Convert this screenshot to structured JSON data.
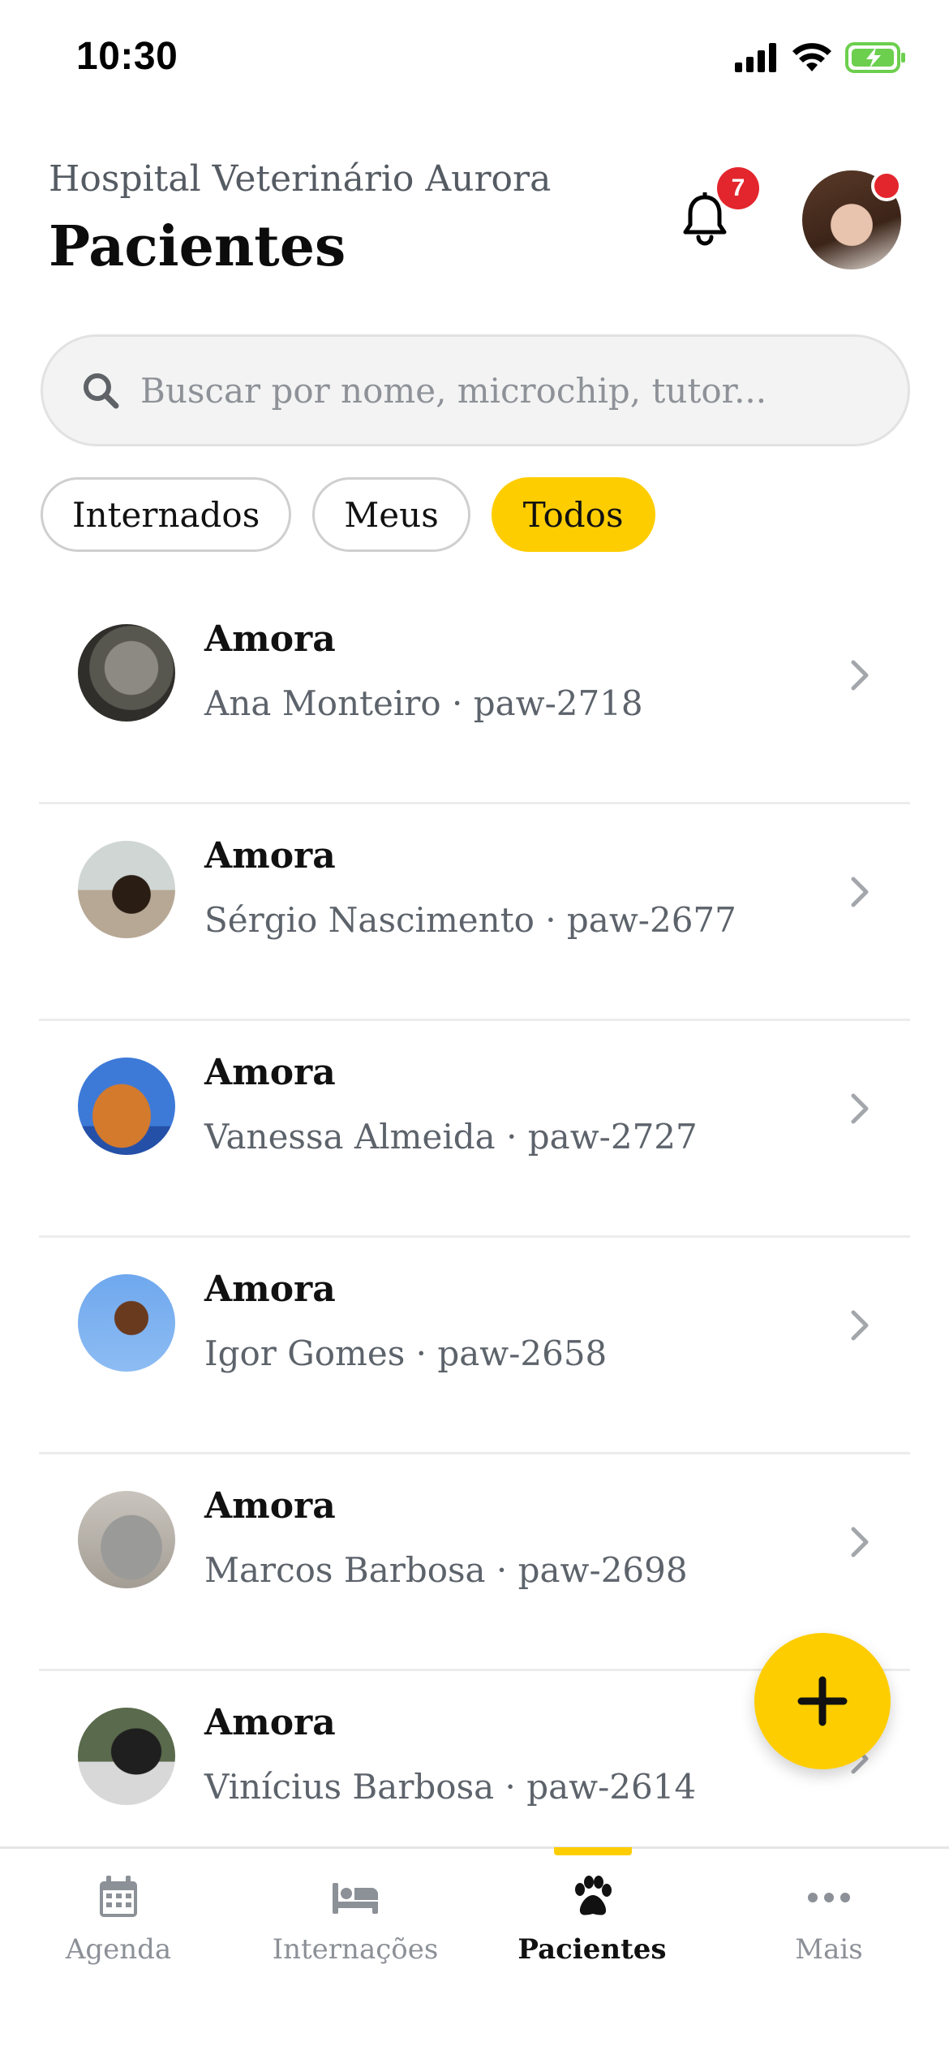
{
  "status_bar": {
    "time": "10:30"
  },
  "header": {
    "hospital_name": "Hospital Veterinário Aurora",
    "title": "Pacientes",
    "notification_count": "7"
  },
  "search": {
    "placeholder": "Buscar por nome, microchip, tutor..."
  },
  "filters": [
    {
      "label": "Internados",
      "active": false
    },
    {
      "label": "Meus",
      "active": false
    },
    {
      "label": "Todos",
      "active": true
    }
  ],
  "patients": [
    {
      "name": "Amora",
      "subtitle": "Ana Monteiro · paw-2718"
    },
    {
      "name": "Amora",
      "subtitle": "Sérgio Nascimento · paw-2677"
    },
    {
      "name": "Amora",
      "subtitle": "Vanessa Almeida · paw-2727"
    },
    {
      "name": "Amora",
      "subtitle": "Igor Gomes · paw-2658"
    },
    {
      "name": "Amora",
      "subtitle": "Marcos Barbosa · paw-2698"
    },
    {
      "name": "Amora",
      "subtitle": "Vinícius Barbosa · paw-2614"
    }
  ],
  "tabs": [
    {
      "label": "Agenda",
      "icon": "calendar-icon",
      "active": false
    },
    {
      "label": "Internações",
      "icon": "bed-icon",
      "active": false
    },
    {
      "label": "Pacientes",
      "icon": "paw-icon",
      "active": true
    },
    {
      "label": "Mais",
      "icon": "more-icon",
      "active": false
    }
  ],
  "colors": {
    "accent": "#FECD00",
    "badge": "#E3262D",
    "muted_text": "#5D636B"
  }
}
